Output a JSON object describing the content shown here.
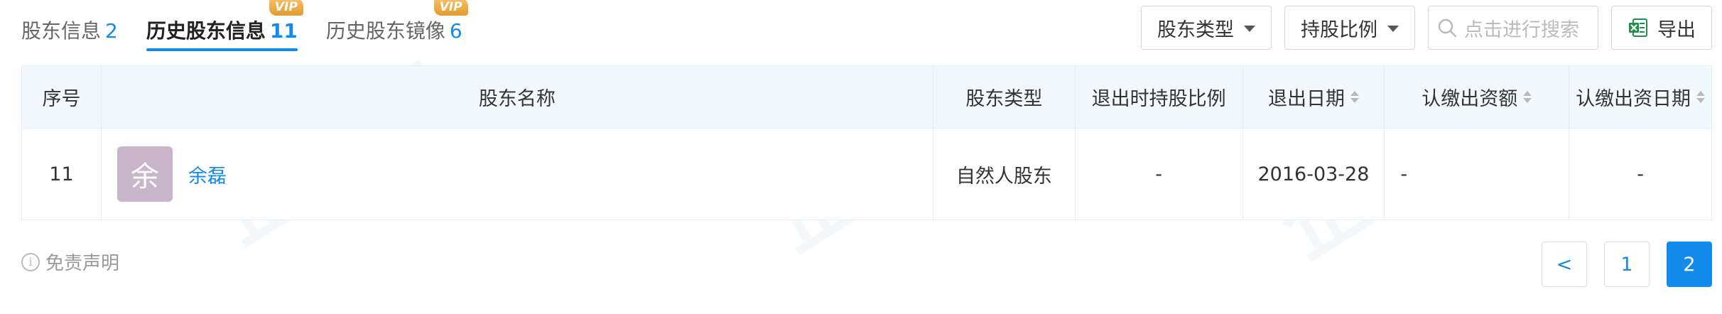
{
  "tabs": [
    {
      "label": "股东信息",
      "count": "2",
      "active": false,
      "vip": false
    },
    {
      "label": "历史股东信息",
      "count": "11",
      "active": true,
      "vip": true
    },
    {
      "label": "历史股东镜像",
      "count": "6",
      "active": false,
      "vip": true
    }
  ],
  "vip_label": "VIP",
  "toolbar": {
    "shareholder_type_label": "股东类型",
    "holding_ratio_label": "持股比例",
    "search_placeholder": "点击进行搜索",
    "export_label": "导出"
  },
  "table": {
    "columns": [
      "序号",
      "股东名称",
      "股东类型",
      "退出时持股比例",
      "退出日期",
      "认缴出资额",
      "认缴出资日期"
    ],
    "rows": [
      {
        "index": "11",
        "avatar_char": "余",
        "name": "余磊",
        "type": "自然人股东",
        "exit_ratio": "-",
        "exit_date": "2016-03-28",
        "subscribed_amount": "-",
        "subscribed_date": "-"
      }
    ]
  },
  "footer": {
    "disclaimer": "免责声明",
    "pagination": {
      "prev": "<",
      "pages": [
        "1",
        "2"
      ],
      "current": "2"
    }
  },
  "colors": {
    "accent": "#128bed",
    "header_bg": "#f2f9fc",
    "avatar_bg": "#c8b5c9",
    "vip": "#e9a23b"
  },
  "icons": [
    "search-icon",
    "excel-icon",
    "info-icon",
    "sort-icon",
    "caret-down-icon"
  ]
}
